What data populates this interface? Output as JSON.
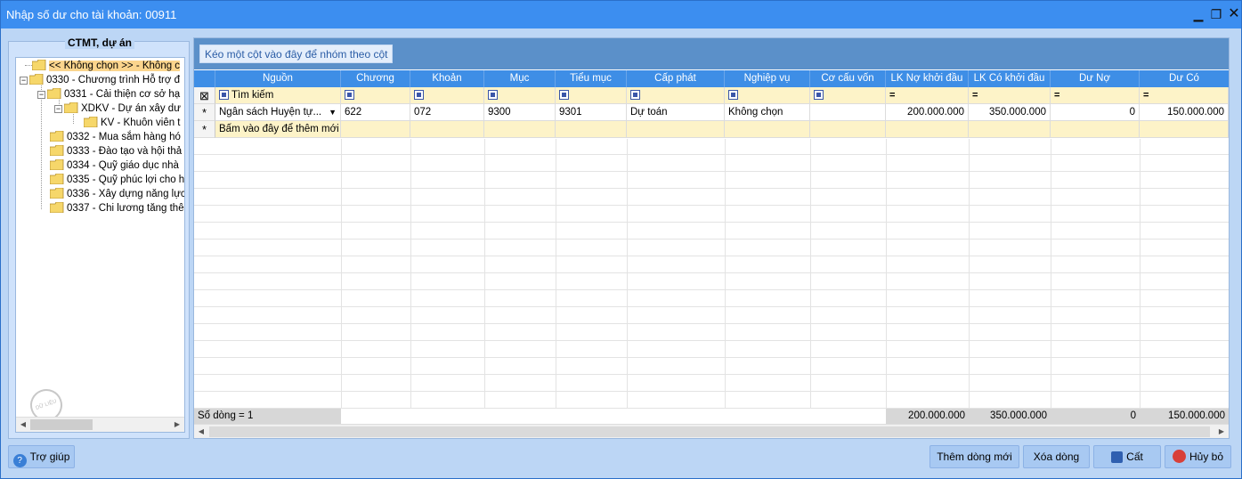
{
  "window": {
    "title": "Nhập số dư cho tài khoản: 00911",
    "min": "▁",
    "max": "❐",
    "close": "✕"
  },
  "left_panel": {
    "title": "CTMT, dự án",
    "tree": [
      {
        "label": "<< Không chọn >> - Không c",
        "selected": true
      },
      {
        "label": "0330 - Chương trình Hỗ trợ đ"
      },
      {
        "label": "0331 - Cải thiện cơ sở hạ"
      },
      {
        "label": "XDKV - Dự án xây dư"
      },
      {
        "label": "KV - Khuôn viên t"
      },
      {
        "label": "0332 - Mua sắm hàng hó"
      },
      {
        "label": "0333 - Đào tạo và hội thả"
      },
      {
        "label": "0334 - Quỹ giáo dục nhà"
      },
      {
        "label": "0335 - Quỹ phúc lợi cho h"
      },
      {
        "label": "0336 - Xây dựng năng lực"
      },
      {
        "label": "0337 - Chi lương tăng thê"
      }
    ],
    "watermark": "DỮ LIỆU MẪU"
  },
  "grid": {
    "group_hint": "Kéo một cột vào đây để nhóm theo cột",
    "columns": [
      "Nguồn",
      "Chương",
      "Khoản",
      "Mục",
      "Tiểu mục",
      "Cấp phát",
      "Nghiệp vụ",
      "Cơ cấu vốn",
      "LK Nợ khởi đầu",
      "LK Có khởi đầu",
      "Dư Nợ",
      "Dư Có"
    ],
    "filter_label": "Tìm kiếm",
    "rows": [
      {
        "nguon": "Ngân sách Huyện tự...",
        "chuong": "622",
        "khoan": "072",
        "muc": "9300",
        "tieu_muc": "9301",
        "cap_phat": "Dự toán",
        "nghiep_vu": "Không chọn",
        "co_cau_von": "",
        "lk_no": "200.000.000",
        "lk_co": "350.000.000",
        "du_no": "0",
        "du_co": "150.000.000"
      }
    ],
    "new_row_hint": "Bấm vào đây để thêm mới",
    "footer": {
      "count_label": "Số dòng = 1",
      "lk_no": "200.000.000",
      "lk_co": "350.000.000",
      "du_no": "0",
      "du_co": "150.000.000"
    }
  },
  "buttons": {
    "help": "Trợ giúp",
    "add_row": "Thêm dòng mới",
    "delete_row": "Xóa dòng",
    "save": "Cất",
    "cancel": "Hủy bỏ"
  },
  "colors": {
    "titlebar": "#3c8ef0",
    "window_bg": "#bcd6f5",
    "grid_header": "#3e8ee6",
    "filter_row": "#fdf3c8",
    "selected_tree": "#fbd58d"
  }
}
